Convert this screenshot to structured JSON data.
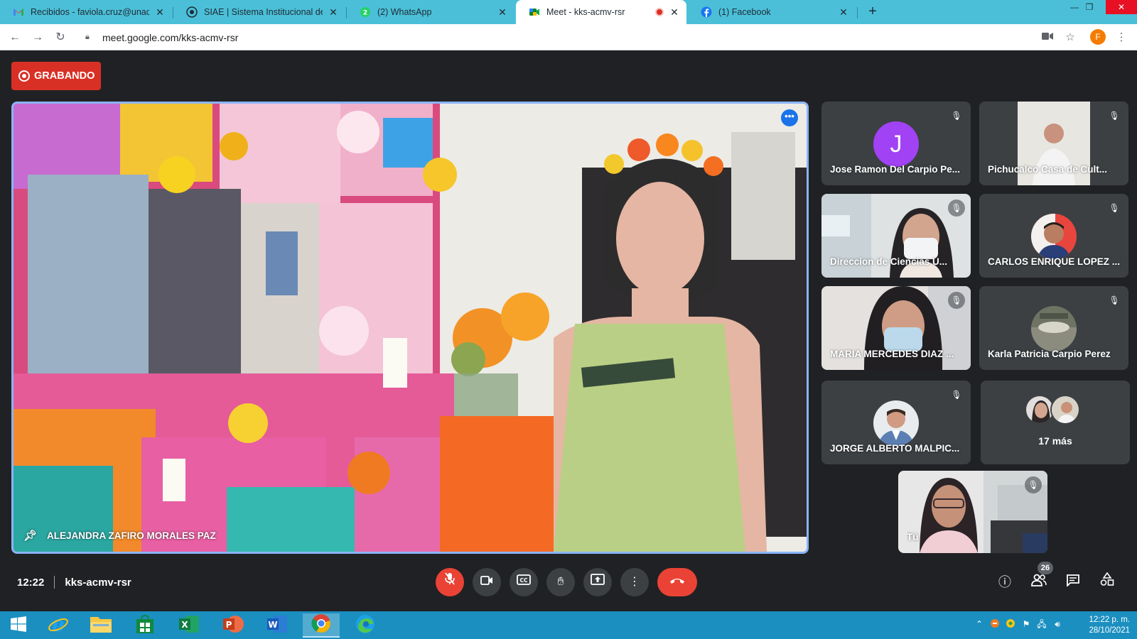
{
  "browser": {
    "tabs": [
      {
        "title": "Recibidos - faviola.cruz@unach.mx",
        "icon": "gmail-icon"
      },
      {
        "title": "SIAE | Sistema Institucional de Ad",
        "icon": "siae-icon"
      },
      {
        "title": "(2) WhatsApp",
        "icon": "whatsapp-icon"
      },
      {
        "title": "Meet - kks-acmv-rsr",
        "icon": "meet-icon"
      },
      {
        "title": "(1) Facebook",
        "icon": "facebook-icon"
      }
    ],
    "address": "meet.google.com/kks-acmv-rsr",
    "profile_initial": "F"
  },
  "meet": {
    "recording_label": "GRABANDO",
    "pinned_name": "ALEJANDRA ZAFIRO MORALES PAZ",
    "participants": [
      {
        "name": "Jose Ramon Del Carpio Pe...",
        "avatar_letter": "J"
      },
      {
        "name": "Pichucalco Casa de Cult..."
      },
      {
        "name": "Direccion de Ciencias U..."
      },
      {
        "name": "CARLOS ENRIQUE LOPEZ ..."
      },
      {
        "name": "MARIA MERCEDES DIAZ ..."
      },
      {
        "name": "Karla Patricia Carpio Perez"
      },
      {
        "name": "JORGE ALBERTO MALPIC..."
      }
    ],
    "more_label": "17 más",
    "self_label": "Tú",
    "time": "12:22",
    "meeting_code": "kks-acmv-rsr",
    "people_count": "26",
    "accent_color": "#8ab4f8",
    "danger_color": "#ea4335"
  },
  "taskbar": {
    "time": "12:22 p. m.",
    "date": "28/10/2021"
  }
}
